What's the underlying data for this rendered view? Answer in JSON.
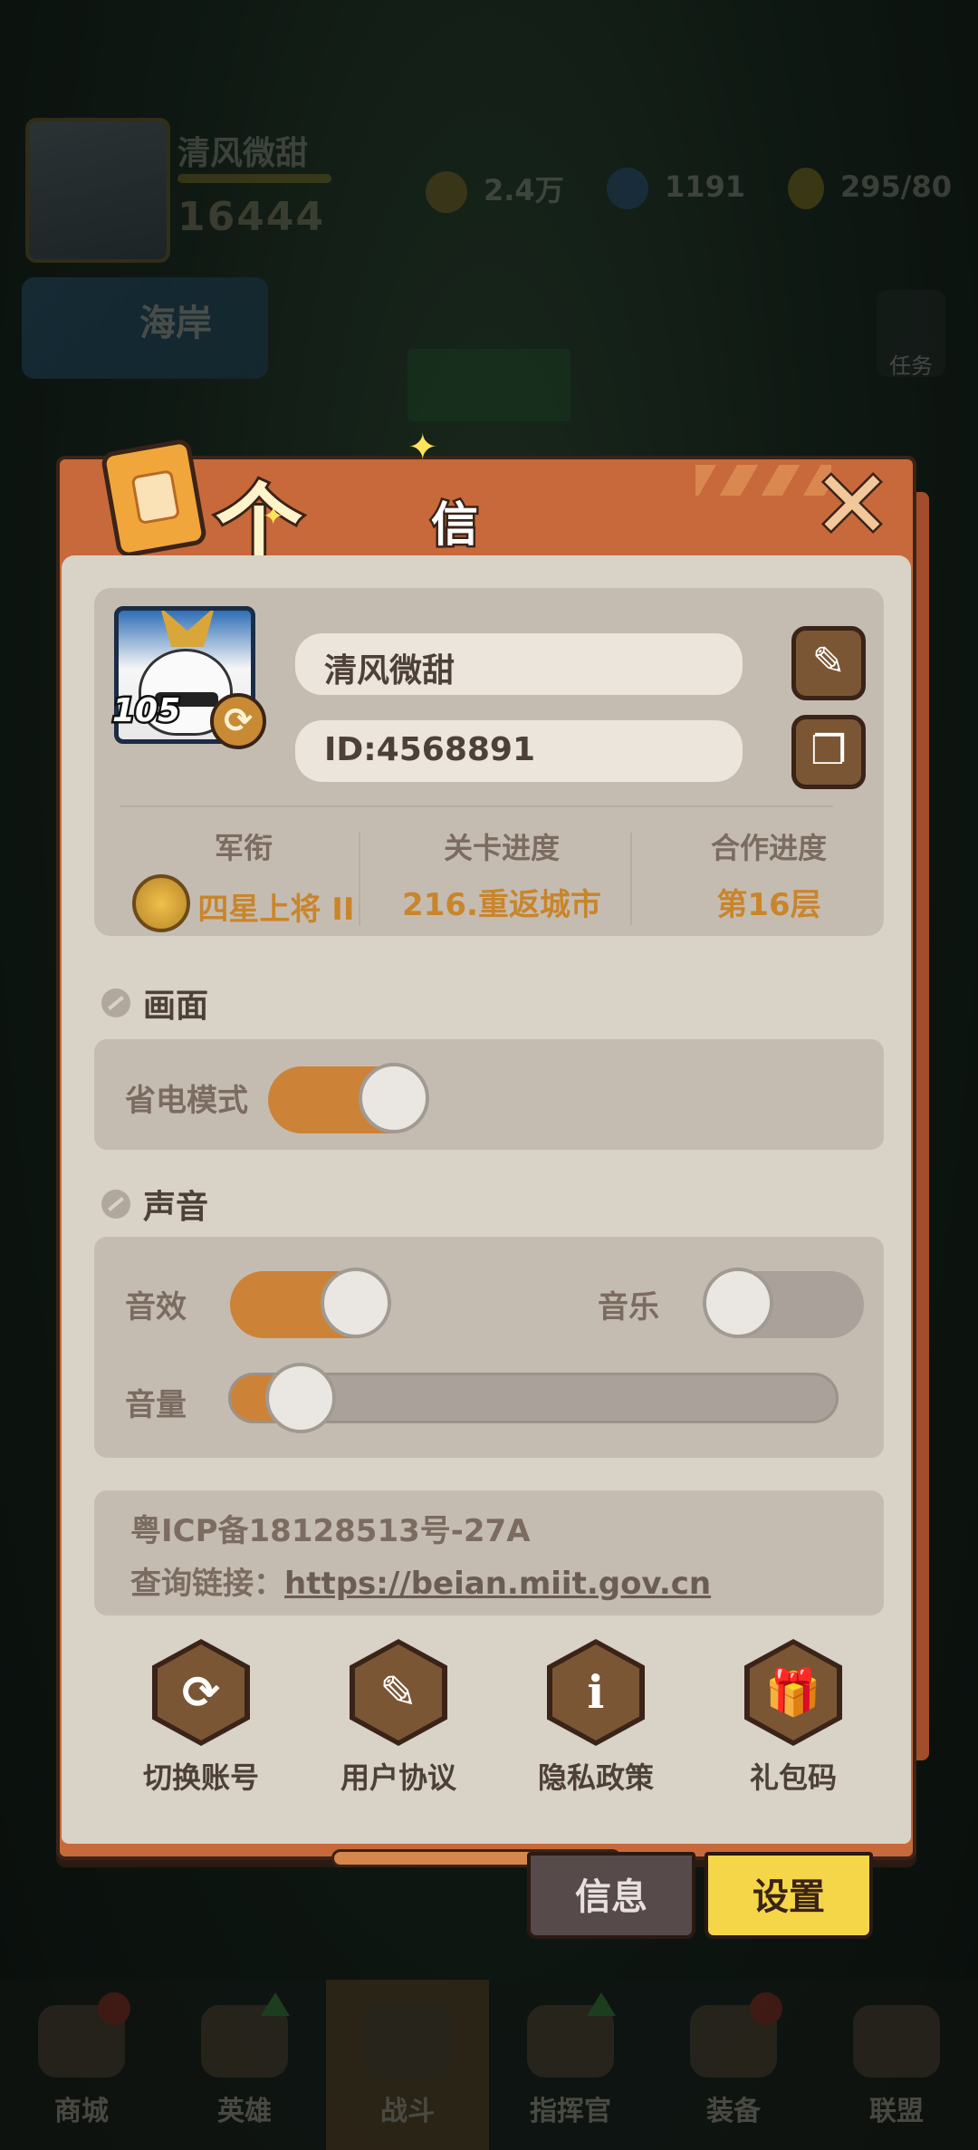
{
  "hud": {
    "player_name": "清风微甜",
    "power": "16444",
    "coins": "2.4万",
    "gems": "1191",
    "energy": "295/80",
    "banner_text": "海岸",
    "task_label": "任务"
  },
  "bottom_nav": {
    "items": [
      {
        "label": "商城"
      },
      {
        "label": "英雄"
      },
      {
        "label": "战斗"
      },
      {
        "label": "指挥官"
      },
      {
        "label": "装备"
      },
      {
        "label": "联盟"
      }
    ]
  },
  "dialog": {
    "title_main": "个人",
    "title_sub": "信息",
    "close_symbol": "✕",
    "profile": {
      "level": "105",
      "name": "清风微甜",
      "id": "ID:4568891",
      "rank_label": "军衔",
      "rank_value": "四星上将 II",
      "stage_label": "关卡进度",
      "stage_value": "216.重返城市",
      "coop_label": "合作进度",
      "coop_value": "第16层"
    },
    "display_section": {
      "title": "画面",
      "power_save_label": "省电模式",
      "power_save_on": true
    },
    "sound_section": {
      "title": "声音",
      "sfx_label": "音效",
      "sfx_on": true,
      "music_label": "音乐",
      "music_on": false,
      "volume_label": "音量",
      "volume_level": 0.05
    },
    "icp": {
      "line1": "粤ICP备18128513号-27A",
      "query_prefix": "查询链接：",
      "link": "https://beian.miit.gov.cn"
    },
    "actions": [
      {
        "label": "切换账号",
        "icon": "switch-icon",
        "glyph": "⟳"
      },
      {
        "label": "用户协议",
        "icon": "agreement-icon",
        "glyph": "✎"
      },
      {
        "label": "隐私政策",
        "icon": "privacy-icon",
        "glyph": "ℹ"
      },
      {
        "label": "礼包码",
        "icon": "gift-icon",
        "glyph": "🎁"
      }
    ],
    "tabs": {
      "info": "信息",
      "settings": "设置"
    }
  }
}
